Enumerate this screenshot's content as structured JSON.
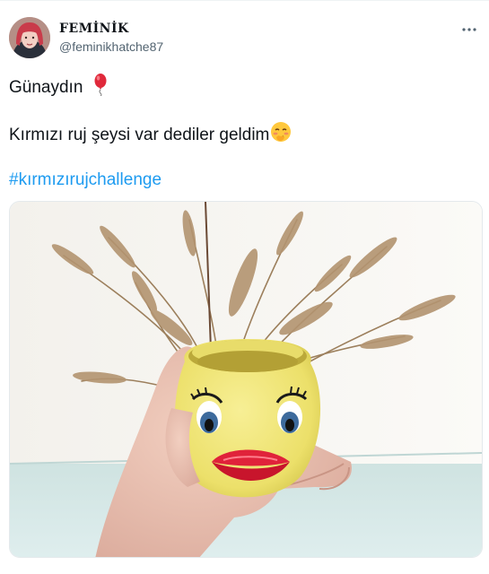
{
  "user": {
    "display_name": "FEMİNİK",
    "handle": "@feminikhatche87",
    "avatar_icon": "profile-avatar"
  },
  "header": {
    "more_icon": "more-horizontal-icon"
  },
  "tweet": {
    "line1": "Günaydın",
    "line1_emoji": "balloon-icon",
    "line2": "Kırmızı ruj şeysi var dediler geldim",
    "line2_emoji": "blushing-face-icon",
    "hashtag": "#kırmızırujchallenge"
  },
  "media": {
    "kind": "photo",
    "subject_icon": "yellow-duck-mug-with-red-lips"
  },
  "colors": {
    "accent": "#1d9bf0",
    "text": "#0f1419",
    "secondary_text": "#536471"
  }
}
